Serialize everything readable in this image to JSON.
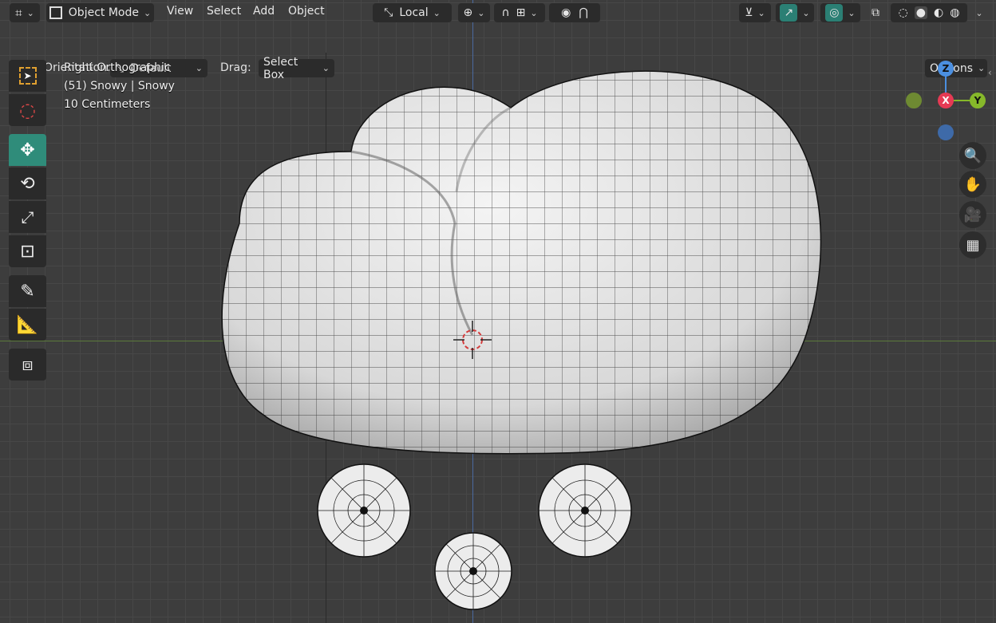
{
  "header": {
    "editor_type_icon": "viewport-editor-icon",
    "mode": "Object Mode",
    "menus": [
      "View",
      "Select",
      "Add",
      "Object"
    ],
    "transform_orientation": "Local"
  },
  "subheader": {
    "orientation_label": "Orientation:",
    "orientation_value": "Default",
    "drag_label": "Drag:",
    "drag_value": "Select Box",
    "options_label": "Options"
  },
  "overlay_info": {
    "view_name": "Right Orthographic",
    "object_info": "(51) Snowy | Snowy",
    "grid_scale": "10 Centimeters"
  },
  "gizmo": {
    "z": "Z",
    "x": "X",
    "y": "Y"
  },
  "colors": {
    "accent_active": "#2f8c7a",
    "axis_x": "#e63a54",
    "axis_y": "#86b82a",
    "axis_z": "#4b8fe0"
  },
  "tools": [
    "select-box-tool",
    "cursor-tool",
    "move-tool",
    "rotate-tool",
    "scale-tool",
    "transform-tool",
    "annotate-tool",
    "measure-tool",
    "add-cube-tool"
  ]
}
